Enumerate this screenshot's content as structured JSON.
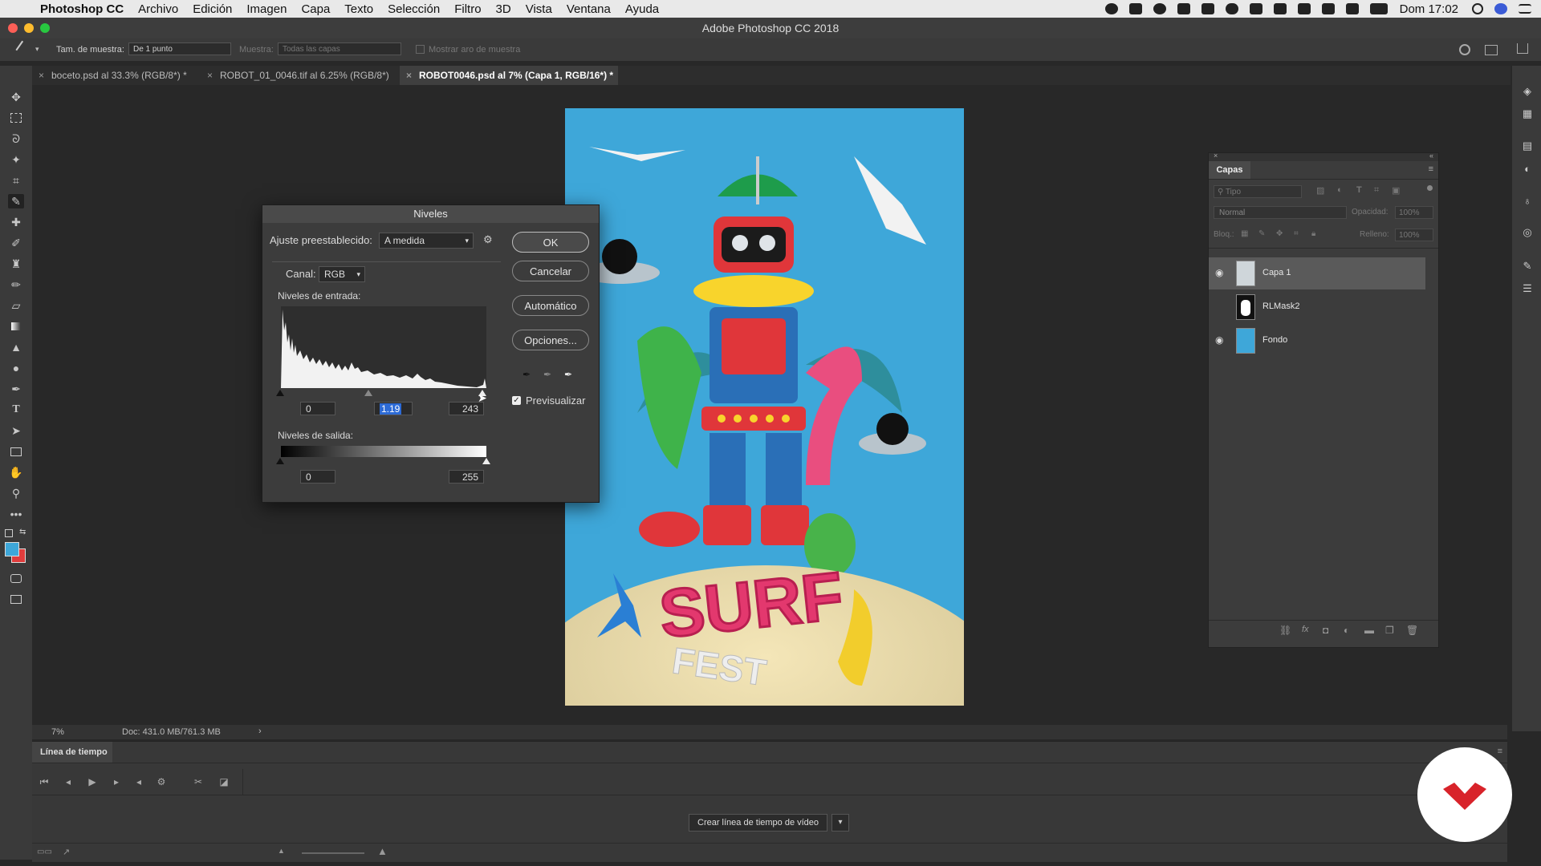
{
  "menubar": {
    "app_name": "Photoshop CC",
    "items": [
      "Archivo",
      "Edición",
      "Imagen",
      "Capa",
      "Texto",
      "Selección",
      "Filtro",
      "3D",
      "Vista",
      "Ventana",
      "Ayuda"
    ],
    "clock": "Dom 17:02"
  },
  "window": {
    "title": "Adobe Photoshop CC 2018"
  },
  "options_bar": {
    "sample_size_label": "Tam. de muestra:",
    "sample_size_value": "De 1 punto",
    "sample_label": "Muestra:",
    "sample_value": "Todas las capas",
    "show_ring_label": "Mostrar aro de muestra"
  },
  "tabs": [
    {
      "label": "boceto.psd al 33.3% (RGB/8*) *"
    },
    {
      "label": "ROBOT_01_0046.tif al 6.25% (RGB/8*)"
    },
    {
      "label": "ROBOT0046.psd al 7% (Capa 1, RGB/16*) *"
    }
  ],
  "status_bar": {
    "zoom": "7%",
    "doc": "Doc: 431.0 MB/761.3 MB"
  },
  "timeline": {
    "title": "Línea de tiempo",
    "create_button": "Crear línea de tiempo de vídeo"
  },
  "artwork": {
    "line1": "SURF",
    "line2": "FEST"
  },
  "layers_panel": {
    "title": "Capas",
    "search_placeholder": "Tipo",
    "blend_mode": "Normal",
    "opacity_label": "Opacidad:",
    "opacity_value": "100%",
    "lock_label": "Bloq.:",
    "fill_label": "Relleno:",
    "fill_value": "100%",
    "layers": [
      {
        "name": "Capa 1",
        "visible": true,
        "selected": true
      },
      {
        "name": "RLMask2",
        "visible": false,
        "selected": false
      },
      {
        "name": "Fondo",
        "visible": true,
        "selected": false
      }
    ]
  },
  "levels_dialog": {
    "title": "Niveles",
    "preset_label": "Ajuste preestablecido:",
    "preset_value": "A medida",
    "channel_label": "Canal:",
    "channel_value": "RGB",
    "input_label": "Niveles de entrada:",
    "input_black": "0",
    "input_gamma": "1.19",
    "input_white": "243",
    "output_label": "Niveles de salida:",
    "output_black": "0",
    "output_white": "255",
    "ok": "OK",
    "cancel": "Cancelar",
    "auto": "Automático",
    "options": "Opciones...",
    "preview_label": "Previsualizar",
    "preview_checked": true
  },
  "colors": {
    "foreground": "#3ea7d9",
    "background": "#e03c3c",
    "canvas_bg": "#3ea7d9",
    "brand": "#d8232a"
  }
}
